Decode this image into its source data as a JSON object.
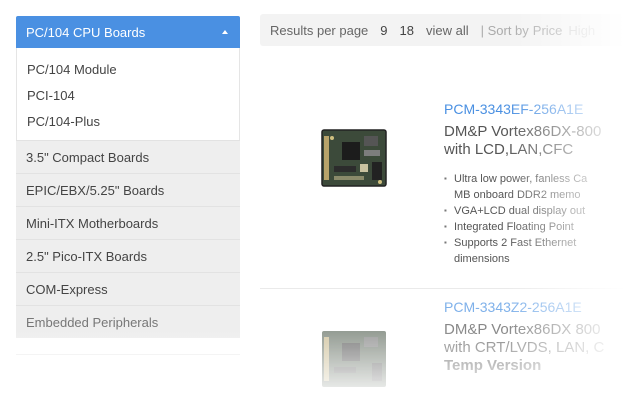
{
  "sidebar": {
    "active_category": "PC/104 CPU Boards",
    "subcategories": [
      "PC/104 Module",
      "PCI-104",
      "PC/104-Plus"
    ],
    "categories": [
      "3.5\" Compact Boards",
      "EPIC/EBX/5.25\" Boards",
      "Mini-ITX Motherboards",
      "2.5\" Pico-ITX Boards",
      "COM-Express",
      "Embedded Peripherals"
    ]
  },
  "toolbar": {
    "results_label": "Results per page",
    "opt_9": "9",
    "opt_18": "18",
    "view_all": "view all",
    "sort_label": "| Sort by",
    "sort_price": "Price",
    "sort_high": "High"
  },
  "products": [
    {
      "title": "PCM-3343EF-256A1E",
      "subtitle_line1": "DM&P Vortex86DX-800",
      "subtitle_line2": "with LCD,LAN,CFC",
      "bullets": [
        "Ultra low power, fanless Ca",
        "MB onboard DDR2 memo",
        "VGA+LCD dual display out",
        "Integrated Floating Point",
        "Supports 2 Fast Ethernet",
        "dimensions"
      ]
    },
    {
      "title": "PCM-3343Z2-256A1E",
      "subtitle_line1": "DM&P Vortex86DX 800",
      "subtitle_line2": "with CRT/LVDS, LAN, C",
      "subtitle_line3": "Temp Version"
    }
  ]
}
